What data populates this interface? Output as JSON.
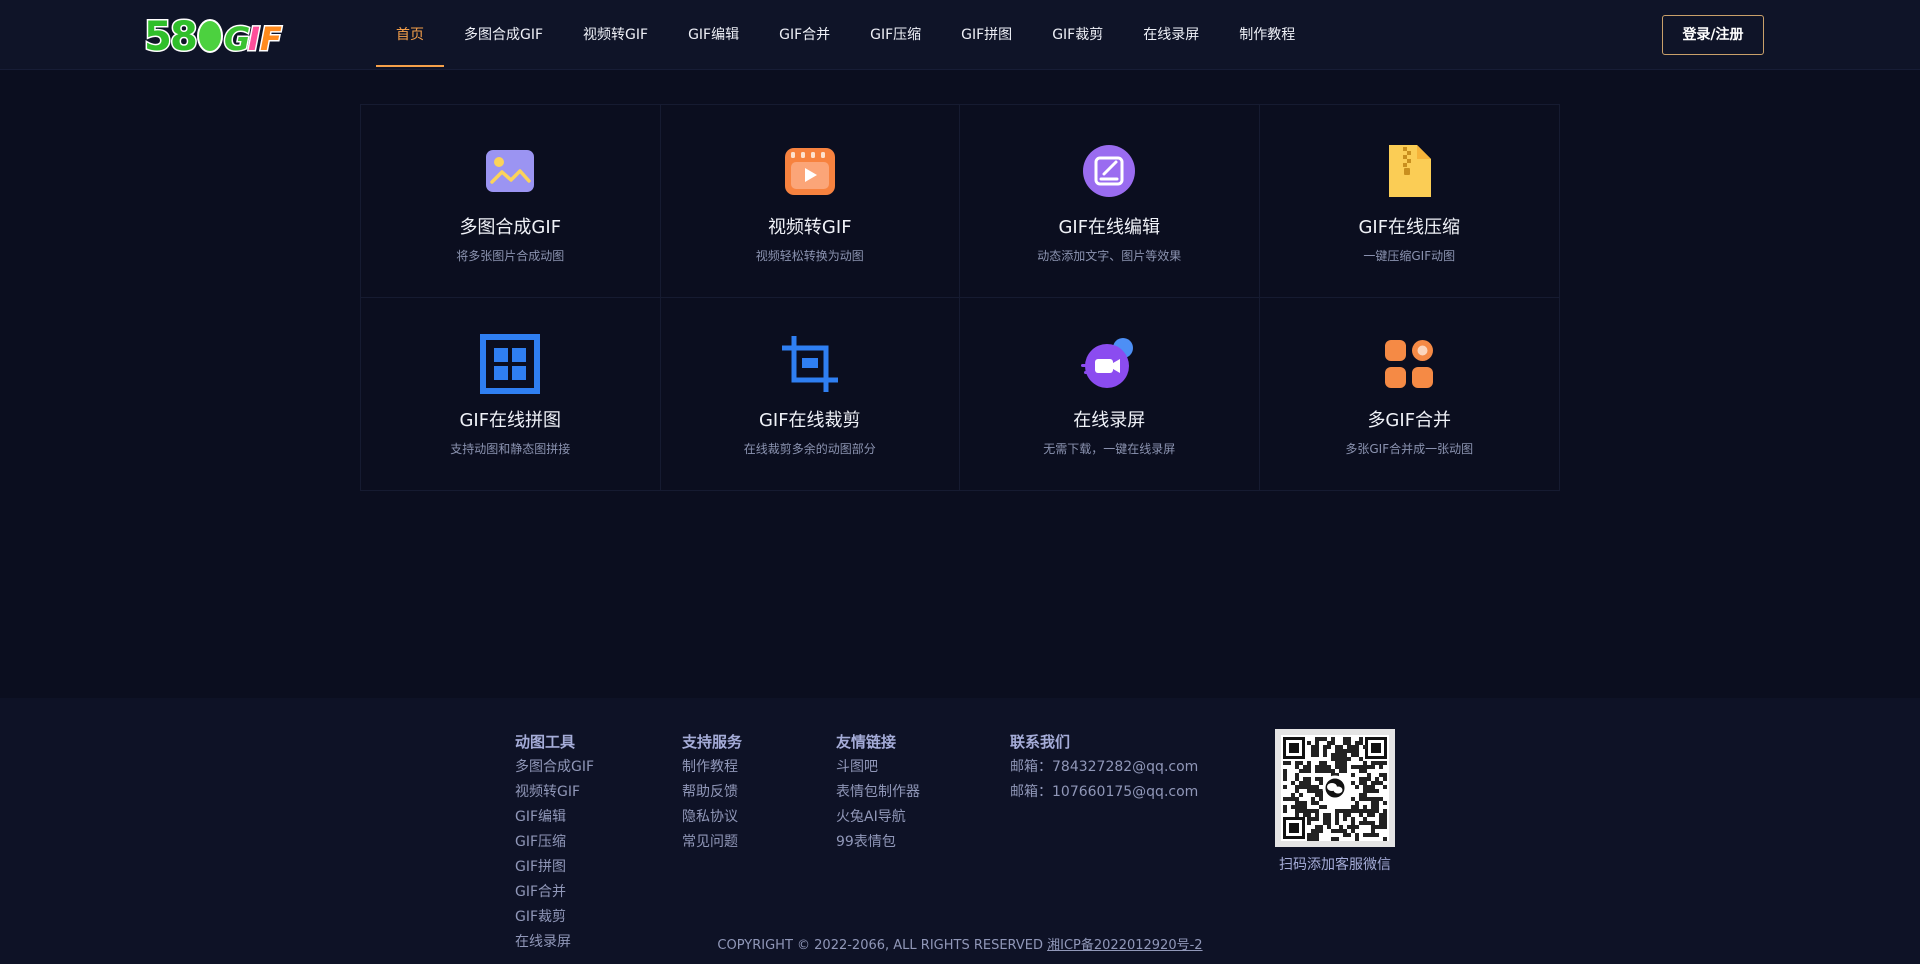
{
  "header": {
    "logo_text": "58GIF",
    "nav": [
      {
        "label": "首页",
        "active": true
      },
      {
        "label": "多图合成GIF"
      },
      {
        "label": "视频转GIF"
      },
      {
        "label": "GIF编辑"
      },
      {
        "label": "GIF合并"
      },
      {
        "label": "GIF压缩"
      },
      {
        "label": "GIF拼图"
      },
      {
        "label": "GIF裁剪"
      },
      {
        "label": "在线录屏"
      },
      {
        "label": "制作教程"
      }
    ],
    "login_label": "登录/注册"
  },
  "tools": [
    {
      "title": "多图合成GIF",
      "desc": "将多张图片合成动图",
      "icon": "image-icon",
      "color": "#9b94f2"
    },
    {
      "title": "视频转GIF",
      "desc": "视频轻松转换为动图",
      "icon": "video-play-icon",
      "color": "#f7823f"
    },
    {
      "title": "GIF在线编辑",
      "desc": "动态添加文字、图片等效果",
      "icon": "edit-icon",
      "color": "#9a6cf0"
    },
    {
      "title": "GIF在线压缩",
      "desc": "一键压缩GIF动图",
      "icon": "zip-file-icon",
      "color": "#fbcd55"
    },
    {
      "title": "GIF在线拼图",
      "desc": "支持动图和静态图拼接",
      "icon": "grid-icon",
      "color": "#2f7ff2"
    },
    {
      "title": "GIF在线裁剪",
      "desc": "在线裁剪多余的动图部分",
      "icon": "crop-icon",
      "color": "#2f7ff2"
    },
    {
      "title": "在线录屏",
      "desc": "无需下载，一键在线录屏",
      "icon": "camera-record-icon",
      "color": "#8b4cf0"
    },
    {
      "title": "多GIF合并",
      "desc": "多张GIF合并成一张动图",
      "icon": "apps-icon",
      "color": "#f58a45"
    }
  ],
  "footer": {
    "columns": [
      {
        "title": "动图工具",
        "links": [
          "多图合成GIF",
          "视频转GIF",
          "GIF编辑",
          "GIF压缩",
          "GIF拼图",
          "GIF合并",
          "GIF裁剪",
          "在线录屏"
        ]
      },
      {
        "title": "支持服务",
        "links": [
          "制作教程",
          "帮助反馈",
          "隐私协议",
          "常见问题"
        ]
      },
      {
        "title": "友情链接",
        "links": [
          "斗图吧",
          "表情包制作器",
          "火兔AI导航",
          "99表情包"
        ]
      },
      {
        "title": "联系我们",
        "links": [
          "邮箱：784327282@qq.com",
          "邮箱：107660175@qq.com"
        ]
      }
    ],
    "qr_caption": "扫码添加客服微信",
    "copyright": "COPYRIGHT © 2022-2066, ALL RIGHTS RESERVED",
    "icp": "湘ICP备2022012920号-2"
  }
}
